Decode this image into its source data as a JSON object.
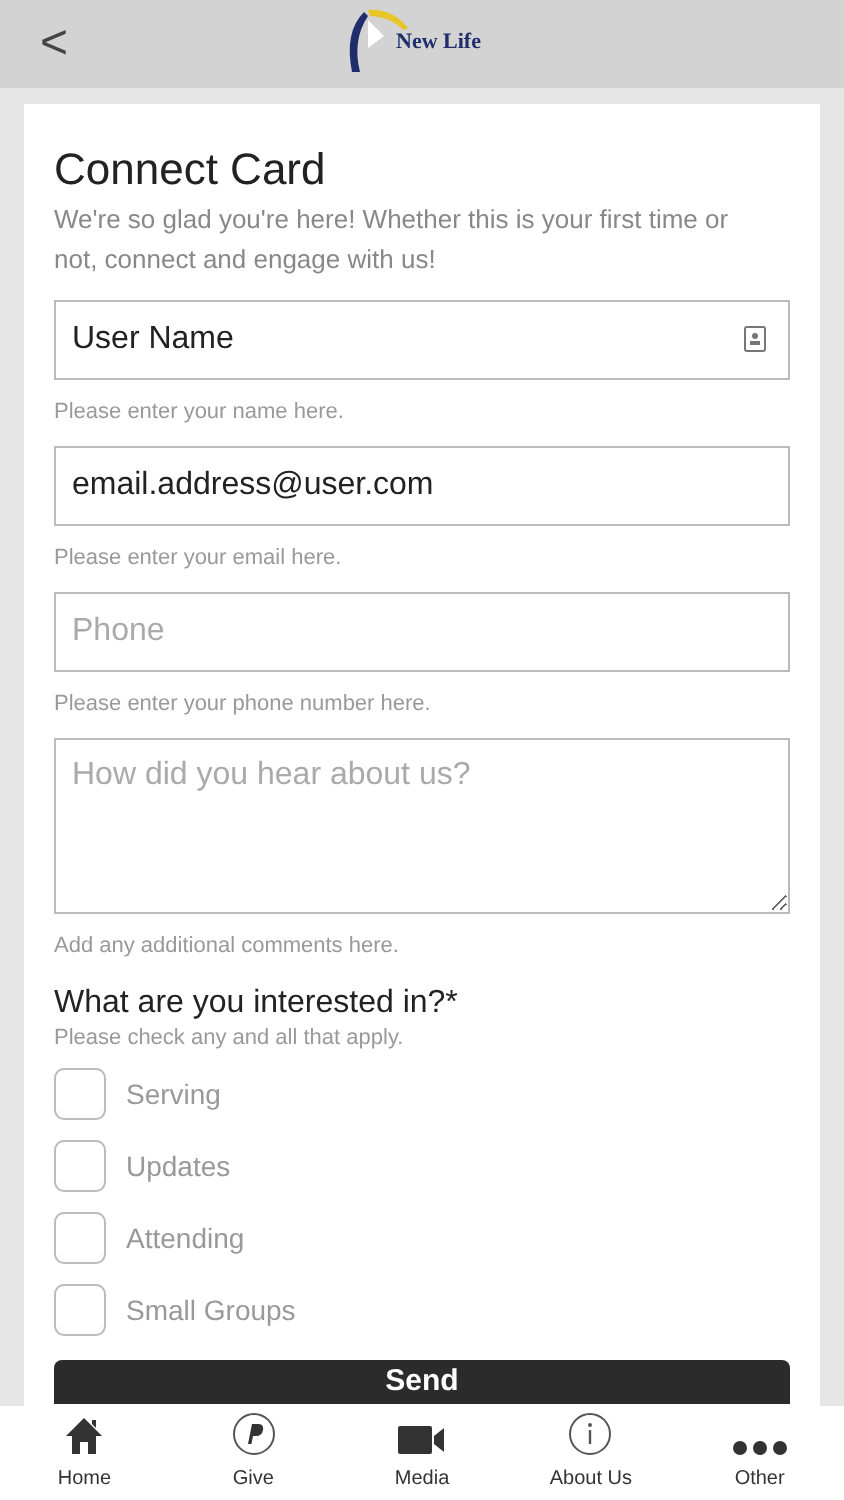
{
  "header": {
    "back": "<",
    "logo_text": "New Life"
  },
  "card": {
    "title": "Connect Card",
    "intro": "We're so glad you're here! Whether this is your first time or not, connect and engage with us!",
    "fields": [
      {
        "kind": "input",
        "value": "User Name",
        "hint": "Please enter your name here.",
        "contact_icon": true
      },
      {
        "kind": "input",
        "value": "email.address@user.com",
        "hint": "Please enter your email here.",
        "contact_icon": false
      },
      {
        "kind": "input",
        "placeholder": "Phone",
        "hint": "Please enter your phone number here.",
        "contact_icon": false
      },
      {
        "kind": "textarea",
        "placeholder": "How did you hear about us?",
        "hint": "Add any additional comments here."
      }
    ],
    "question": "What are you interested in?*",
    "question_hint": "Please check any and all that apply.",
    "options": [
      {
        "label": "Serving",
        "checked": false
      },
      {
        "label": "Updates",
        "checked": false
      },
      {
        "label": "Attending",
        "checked": false
      },
      {
        "label": "Small Groups",
        "checked": false
      }
    ],
    "submit": "Send"
  },
  "tab_bar": [
    {
      "kind": "home",
      "label": "Home"
    },
    {
      "kind": "give",
      "label": "Give"
    },
    {
      "kind": "media",
      "label": "Media"
    },
    {
      "kind": "info",
      "label": "About Us"
    },
    {
      "kind": "more",
      "label": "Other"
    }
  ]
}
